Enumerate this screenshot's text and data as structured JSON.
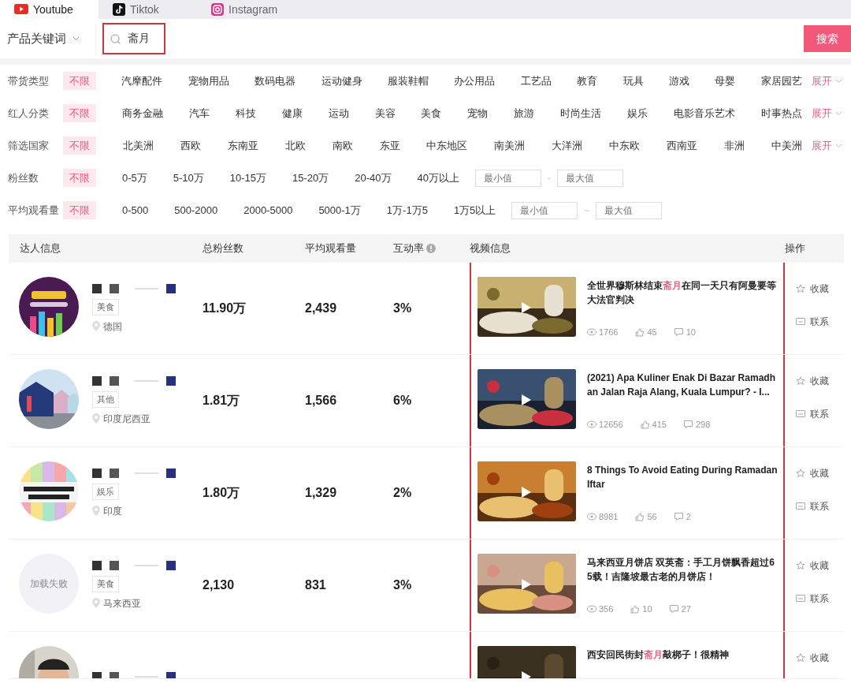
{
  "platform_tabs": [
    {
      "label": "Youtube",
      "selected": true
    },
    {
      "label": "Tiktok",
      "selected": false
    },
    {
      "label": "Instagram",
      "selected": false
    }
  ],
  "search": {
    "scope": "产品关键词",
    "value": "斋月",
    "highlighted": true,
    "button": "搜索"
  },
  "filters": [
    {
      "label": "带货类型",
      "options": [
        {
          "text": "不限",
          "selected": true
        },
        {
          "text": "汽摩配件",
          "selected": false
        },
        {
          "text": "宠物用品",
          "selected": false
        },
        {
          "text": "数码电器",
          "selected": false
        },
        {
          "text": "运动健身",
          "selected": false
        },
        {
          "text": "服装鞋帽",
          "selected": false
        },
        {
          "text": "办公用品",
          "selected": false
        },
        {
          "text": "工艺品",
          "selected": false
        },
        {
          "text": "教育",
          "selected": false
        },
        {
          "text": "玩具",
          "selected": false
        },
        {
          "text": "游戏",
          "selected": false
        },
        {
          "text": "母婴",
          "selected": false
        },
        {
          "text": "家居园艺",
          "selected": false
        }
      ],
      "expand": "展开"
    },
    {
      "label": "红人分类",
      "options": [
        {
          "text": "不限",
          "selected": true
        },
        {
          "text": "商务金融",
          "selected": false
        },
        {
          "text": "汽车",
          "selected": false
        },
        {
          "text": "科技",
          "selected": false
        },
        {
          "text": "健康",
          "selected": false
        },
        {
          "text": "运动",
          "selected": false
        },
        {
          "text": "美容",
          "selected": false
        },
        {
          "text": "美食",
          "selected": false
        },
        {
          "text": "宠物",
          "selected": false
        },
        {
          "text": "旅游",
          "selected": false
        },
        {
          "text": "时尚生活",
          "selected": false
        },
        {
          "text": "娱乐",
          "selected": false
        },
        {
          "text": "电影音乐艺术",
          "selected": false
        },
        {
          "text": "时事热点",
          "selected": false
        }
      ],
      "expand": "展开"
    },
    {
      "label": "筛选国家",
      "options": [
        {
          "text": "不限",
          "selected": true
        },
        {
          "text": "北美洲",
          "selected": false
        },
        {
          "text": "西欧",
          "selected": false
        },
        {
          "text": "东南亚",
          "selected": false
        },
        {
          "text": "北欧",
          "selected": false
        },
        {
          "text": "南欧",
          "selected": false
        },
        {
          "text": "东亚",
          "selected": false
        },
        {
          "text": "中东地区",
          "selected": false
        },
        {
          "text": "南美洲",
          "selected": false
        },
        {
          "text": "大洋洲",
          "selected": false
        },
        {
          "text": "中东欧",
          "selected": false
        },
        {
          "text": "西南亚",
          "selected": false
        },
        {
          "text": "非洲",
          "selected": false
        },
        {
          "text": "中美洲",
          "selected": false
        }
      ],
      "expand": "展开"
    },
    {
      "label": "粉丝数",
      "options": [
        {
          "text": "不限",
          "selected": true
        },
        {
          "text": "0-5万",
          "selected": false
        },
        {
          "text": "5-10万",
          "selected": false
        },
        {
          "text": "10-15万",
          "selected": false
        },
        {
          "text": "15-20万",
          "selected": false
        },
        {
          "text": "20-40万",
          "selected": false
        },
        {
          "text": "40万以上",
          "selected": false
        }
      ],
      "range": {
        "min_placeholder": "最小值",
        "separator": "-",
        "max_placeholder": "最大值"
      }
    },
    {
      "label": "平均观看量",
      "options": [
        {
          "text": "不限",
          "selected": true
        },
        {
          "text": "0-500",
          "selected": false
        },
        {
          "text": "500-2000",
          "selected": false
        },
        {
          "text": "2000-5000",
          "selected": false
        },
        {
          "text": "5000-1万",
          "selected": false
        },
        {
          "text": "1万-1万5",
          "selected": false
        },
        {
          "text": "1万5以上",
          "selected": false
        }
      ],
      "range": {
        "min_placeholder": "最小值",
        "separator": "~",
        "max_placeholder": "最大值"
      }
    }
  ],
  "table": {
    "columns": [
      "达人信息",
      "总粉丝数",
      "平均观看量",
      "互动率",
      "视频信息",
      "操作"
    ],
    "video_column_highlighted": true,
    "rows": [
      {
        "tag": "美食",
        "location": "德国",
        "followers": "11.90万",
        "avg_views": "2,439",
        "engagement": "3%",
        "video": {
          "title_parts": [
            {
              "text": "全世界穆斯林结束",
              "highlight": false
            },
            {
              "text": "斋月",
              "highlight": true
            },
            {
              "text": "在同一天只有阿曼要等大法官判决",
              "highlight": false
            }
          ],
          "views": "1766",
          "likes": "45",
          "comments": "10"
        },
        "actions": [
          "收藏",
          "联系"
        ]
      },
      {
        "tag": "其他",
        "location": "印度尼西亚",
        "followers": "1.81万",
        "avg_views": "1,566",
        "engagement": "6%",
        "video": {
          "title_parts": [
            {
              "text": "(2021) Apa Kuliner Enak Di Bazar Ramadhan Jalan Raja Alang, Kuala Lumpur? - I...",
              "highlight": false
            }
          ],
          "views": "12656",
          "likes": "415",
          "comments": "298"
        },
        "actions": [
          "收藏",
          "联系"
        ]
      },
      {
        "tag": "娱乐",
        "location": "印度",
        "followers": "1.80万",
        "avg_views": "1,329",
        "engagement": "2%",
        "video": {
          "title_parts": [
            {
              "text": "8 Things To Avoid Eating During Ramadan Iftar",
              "highlight": false
            }
          ],
          "views": "8981",
          "likes": "56",
          "comments": "2"
        },
        "actions": [
          "收藏",
          "联系"
        ]
      },
      {
        "avatar_text": "加载失败",
        "tag": "美食",
        "location": "马来西亚",
        "followers": "2,130",
        "avg_views": "831",
        "engagement": "3%",
        "video": {
          "title_parts": [
            {
              "text": "马来西亚月饼店 双英斋：手工月饼飘香超过65载！吉隆坡最古老的月饼店！",
              "highlight": false
            }
          ],
          "views": "356",
          "likes": "10",
          "comments": "27"
        },
        "actions": [
          "收藏",
          "联系"
        ]
      },
      {
        "video": {
          "title_parts": [
            {
              "text": "西安回民街封",
              "highlight": false
            },
            {
              "text": "斋月",
              "highlight": true
            },
            {
              "text": "敲梆子！很精神",
              "highlight": false
            }
          ]
        },
        "actions": [
          "收藏"
        ]
      }
    ]
  }
}
